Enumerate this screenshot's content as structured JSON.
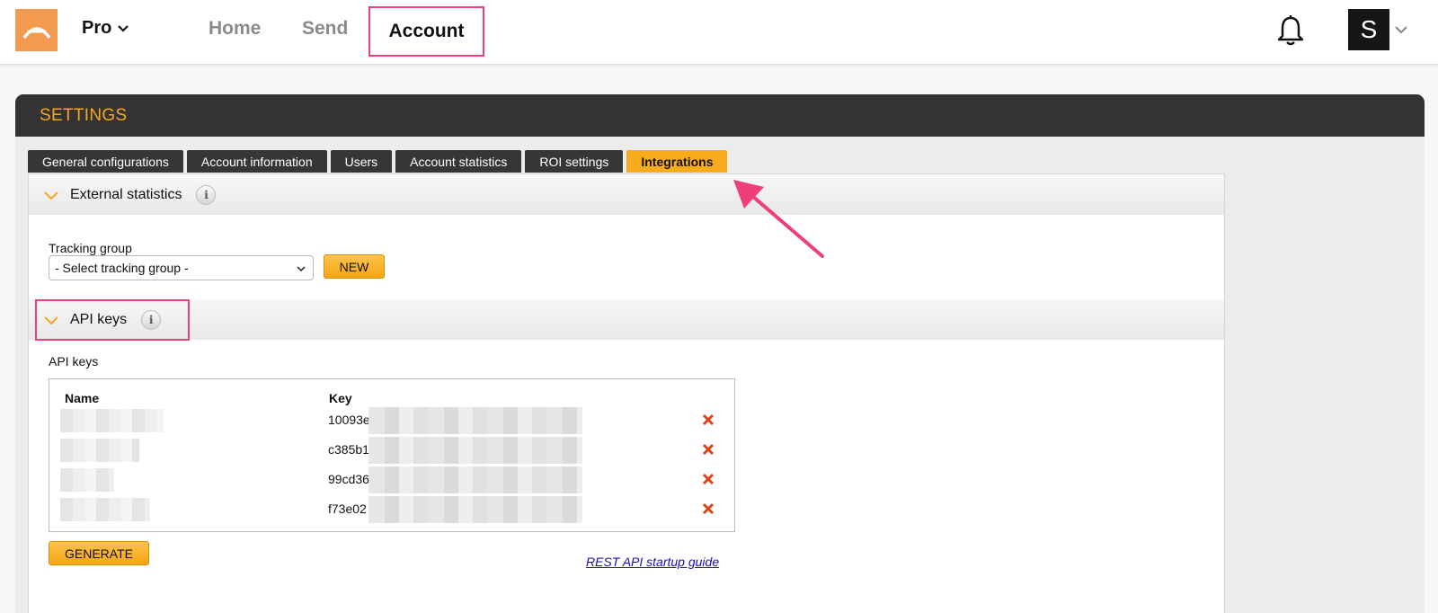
{
  "topnav": {
    "plan": "Pro",
    "links": {
      "home": "Home",
      "send": "Send",
      "account": "Account"
    },
    "avatar_letter": "S"
  },
  "settings": {
    "title": "SETTINGS",
    "tabs": [
      {
        "label": "General configurations",
        "active": false
      },
      {
        "label": "Account information",
        "active": false
      },
      {
        "label": "Users",
        "active": false
      },
      {
        "label": "Account statistics",
        "active": false
      },
      {
        "label": "ROI settings",
        "active": false
      },
      {
        "label": "Integrations",
        "active": true
      }
    ]
  },
  "external_statistics": {
    "heading": "External statistics",
    "tracking_group_label": "Tracking group",
    "select_value": "- Select tracking group -",
    "new_button": "NEW"
  },
  "api_keys": {
    "heading": "API keys",
    "sub_label": "API keys",
    "columns": {
      "name": "Name",
      "key": "Key"
    },
    "rows": [
      {
        "key_prefix": "10093e"
      },
      {
        "key_prefix": "c385b1"
      },
      {
        "key_prefix": "99cd36"
      },
      {
        "key_prefix": "f73e02"
      }
    ],
    "generate_button": "GENERATE",
    "guide_link": "REST API startup guide"
  },
  "colors": {
    "accent_orange": "#f8ac1b",
    "logo_orange": "#f19a50",
    "highlight_pink": "#ee3f7b",
    "header_dark": "#333333",
    "delete_red": "#e0421b"
  }
}
